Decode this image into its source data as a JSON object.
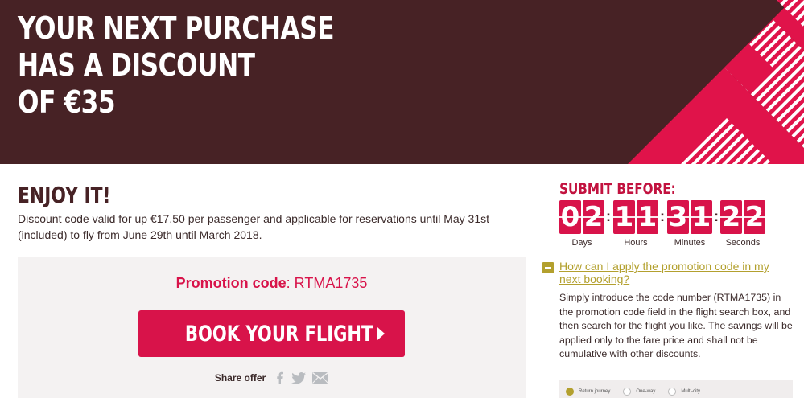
{
  "hero": {
    "title": "YOUR NEXT PURCHASE\nHAS A DISCOUNT\nOF €35"
  },
  "offer": {
    "heading": "ENJOY IT!",
    "description": "Discount code valid for up €17.50 per passenger and applicable for reservations until May 31st (included) to fly from June 29th until March 2018."
  },
  "promo": {
    "label": "Promotion code",
    "separator": ": ",
    "code": "RTMA1735",
    "button_label": "BOOK YOUR FLIGHT",
    "share_label": "Share offer",
    "share_icons": [
      "facebook-icon",
      "twitter-icon",
      "email-icon"
    ]
  },
  "countdown": {
    "title": "SUBMIT BEFORE:",
    "units": [
      {
        "label": "Days",
        "digits": [
          "0",
          "2"
        ]
      },
      {
        "label": "Hours",
        "digits": [
          "1",
          "1"
        ]
      },
      {
        "label": "Minutes",
        "digits": [
          "3",
          "1"
        ]
      },
      {
        "label": "Seconds",
        "digits": [
          "2",
          "2"
        ]
      }
    ],
    "separator": ":"
  },
  "faq": {
    "question": "How can I apply the promotion code in my next booking?",
    "answer": "Simply introduce the code number (RTMA1735) in the promotion code field in the flight search box, and then search for the flight you like. The savings will be applied only to the fare price and shall not be cumulative with other discounts."
  },
  "search_preview": {
    "options": [
      {
        "label": "Return journey",
        "checked": true
      },
      {
        "label": "One-way",
        "checked": false
      },
      {
        "label": "Multi-city",
        "checked": false
      }
    ]
  },
  "colors": {
    "hero_bg": "#472225",
    "accent": "#d8134a",
    "link": "#b3a02e"
  }
}
